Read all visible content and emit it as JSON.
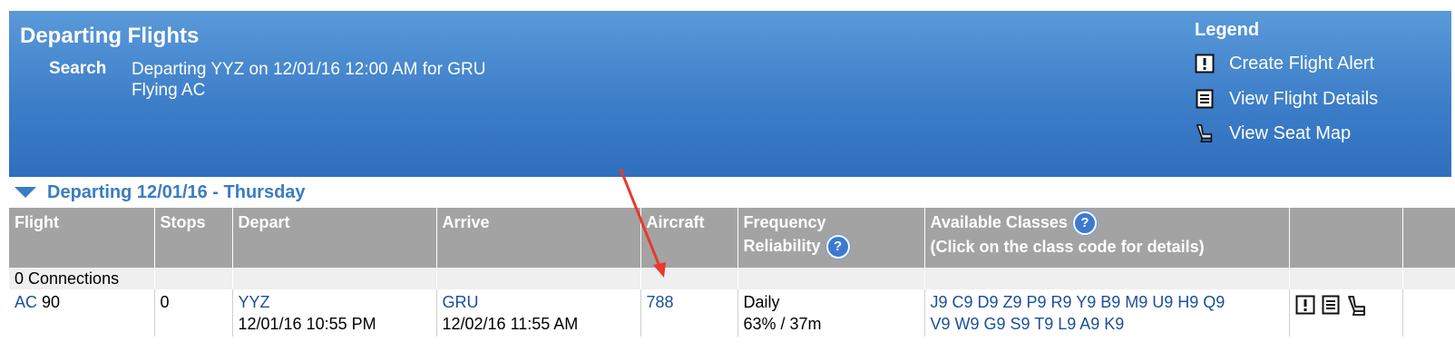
{
  "header": {
    "title": "Departing Flights",
    "search_label": "Search",
    "search_line1": "Departing YYZ on 12/01/16 12:00 AM for GRU",
    "search_line2": "Flying AC"
  },
  "legend": {
    "title": "Legend",
    "items": [
      {
        "icon": "alert-icon",
        "label": "Create Flight Alert"
      },
      {
        "icon": "details-icon",
        "label": "View Flight Details"
      },
      {
        "icon": "seat-icon",
        "label": "View Seat Map"
      }
    ]
  },
  "section": {
    "label": "Departing 12/01/16 - Thursday"
  },
  "table": {
    "headers": {
      "flight": "Flight",
      "stops": "Stops",
      "depart": "Depart",
      "arrive": "Arrive",
      "aircraft": "Aircraft",
      "freq_line1": "Frequency",
      "freq_line2": "Reliability",
      "classes_line1": "Available Classes",
      "classes_line2": "(Click on the class code for details)"
    },
    "connections_label": "0 Connections",
    "row": {
      "airline": "AC",
      "flight_no": "90",
      "stops": "0",
      "depart_code": "YYZ",
      "depart_time": "12/01/16 10:55 PM",
      "arrive_code": "GRU",
      "arrive_time": "12/02/16 11:55 AM",
      "aircraft": "788",
      "frequency": "Daily",
      "reliability": "63% / 37m",
      "classes_line1": "J9 C9 D9 Z9 P9 R9 Y9 B9 M9 U9 H9 Q9",
      "classes_line2": "V9 W9 G9 S9 T9 L9 A9 K9"
    }
  },
  "colors": {
    "header_bg": "#3d7ec9",
    "link": "#1a4f9c",
    "section": "#3a7cc2",
    "table_header_bg": "#a3a3a3",
    "annotation_arrow": "#e8392b"
  }
}
